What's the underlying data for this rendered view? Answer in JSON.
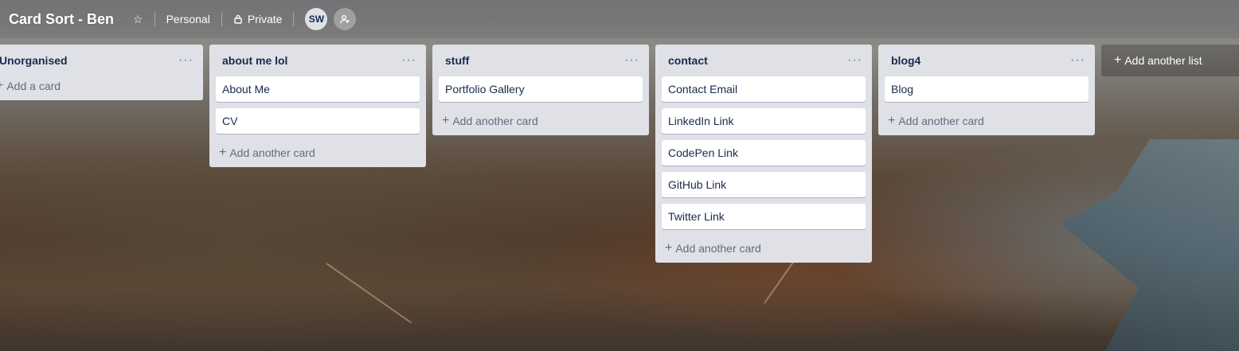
{
  "header": {
    "board_title": "Card Sort - Ben",
    "team_label": "Personal",
    "visibility_label": "Private",
    "member_initials": "SW",
    "star_icon": "star-icon",
    "lock_icon": "lock-icon",
    "add_member_icon": "add-member-icon"
  },
  "lists": [
    {
      "title": "Unorganised",
      "cards": [],
      "add_label": "Add a card"
    },
    {
      "title": "about me lol",
      "cards": [
        "About Me",
        "CV"
      ],
      "add_label": "Add another card"
    },
    {
      "title": "stuff",
      "cards": [
        "Portfolio Gallery"
      ],
      "add_label": "Add another card"
    },
    {
      "title": "contact",
      "cards": [
        "Contact Email",
        "LinkedIn Link",
        "CodePen Link",
        "GitHub Link",
        "Twitter Link"
      ],
      "add_label": "Add another card"
    },
    {
      "title": "blog4",
      "cards": [
        "Blog"
      ],
      "add_label": "Add another card"
    }
  ],
  "add_list_label": "Add another list",
  "list_menu_glyph": "···",
  "colors": {
    "list_bg": "#dfe1e6",
    "card_bg": "#ffffff",
    "text": "#172b4d",
    "muted": "#5e6c84"
  }
}
